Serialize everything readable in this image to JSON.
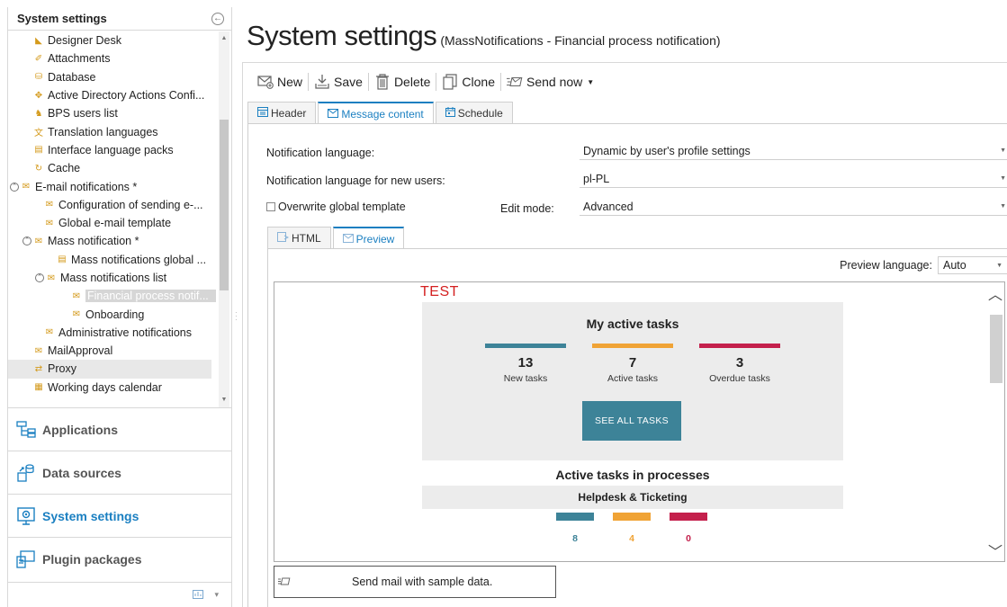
{
  "left": {
    "title": "System settings",
    "collapse_glyph": "←",
    "tree": [
      {
        "label": "Designer Desk",
        "icon": "pencil-ruler-icon",
        "glyph": "◣",
        "color": "#d49a1c",
        "indent": 28,
        "exp": ""
      },
      {
        "label": "Attachments",
        "icon": "paperclip-icon",
        "glyph": "✐",
        "color": "#d49a1c",
        "indent": 28,
        "exp": ""
      },
      {
        "label": "Database",
        "icon": "database-icon",
        "glyph": "⛁",
        "color": "#d49a1c",
        "indent": 28,
        "exp": ""
      },
      {
        "label": "Active Directory Actions Confi...",
        "icon": "directory-icon",
        "glyph": "✥",
        "color": "#d49a1c",
        "indent": 28,
        "exp": ""
      },
      {
        "label": "BPS users list",
        "icon": "users-icon",
        "glyph": "♞",
        "color": "#d49a1c",
        "indent": 28,
        "exp": ""
      },
      {
        "label": "Translation languages",
        "icon": "translate-icon",
        "glyph": "文",
        "color": "#d49a1c",
        "indent": 28,
        "exp": ""
      },
      {
        "label": "Interface language packs",
        "icon": "language-pack-icon",
        "glyph": "▤",
        "color": "#d49a1c",
        "indent": 28,
        "exp": ""
      },
      {
        "label": "Cache",
        "icon": "cache-icon",
        "glyph": "↻",
        "color": "#d49a1c",
        "indent": 28,
        "exp": ""
      },
      {
        "label": "E-mail notifications *",
        "icon": "envelope-icon",
        "glyph": "✉",
        "color": "#d49a1c",
        "indent": 14,
        "exp": "⊙"
      },
      {
        "label": "Configuration of sending e-...",
        "icon": "mail-config-icon",
        "glyph": "✉",
        "color": "#d49a1c",
        "indent": 40,
        "exp": ""
      },
      {
        "label": "Global e-mail template",
        "icon": "mail-template-icon",
        "glyph": "✉",
        "color": "#d49a1c",
        "indent": 40,
        "exp": ""
      },
      {
        "label": "Mass notification *",
        "icon": "mass-mail-icon",
        "glyph": "✉",
        "color": "#d49a1c",
        "indent": 28,
        "exp": "⊙"
      },
      {
        "label": "Mass notifications global ...",
        "icon": "mass-mail-global-icon",
        "glyph": "▤",
        "color": "#d49a1c",
        "indent": 54,
        "exp": ""
      },
      {
        "label": "Mass notifications list",
        "icon": "mass-mail-list-icon",
        "glyph": "✉",
        "color": "#d49a1c",
        "indent": 42,
        "exp": "⊙"
      },
      {
        "label": "Financial process notif...",
        "icon": "notification-item-icon",
        "glyph": "✉",
        "color": "#d49a1c",
        "indent": 70,
        "exp": "",
        "selected": true
      },
      {
        "label": "Onboarding",
        "icon": "notification-item-icon",
        "glyph": "✉",
        "color": "#d49a1c",
        "indent": 70,
        "exp": ""
      },
      {
        "label": "Administrative notifications",
        "icon": "admin-mail-icon",
        "glyph": "✉",
        "color": "#d49a1c",
        "indent": 40,
        "exp": ""
      },
      {
        "label": "MailApproval",
        "icon": "mail-approval-icon",
        "glyph": "✉",
        "color": "#d49a1c",
        "indent": 28,
        "exp": ""
      },
      {
        "label": "Proxy",
        "icon": "proxy-icon",
        "glyph": "⇄",
        "color": "#d49a1c",
        "indent": 28,
        "exp": "",
        "hover": true
      },
      {
        "label": "Working days calendar",
        "icon": "calendar-icon",
        "glyph": "▦",
        "color": "#d49a1c",
        "indent": 28,
        "exp": ""
      }
    ],
    "nav": [
      {
        "label": "Applications",
        "icon": "applications-icon",
        "active": false
      },
      {
        "label": "Data sources",
        "icon": "data-sources-icon",
        "active": false
      },
      {
        "label": "System settings",
        "icon": "system-settings-icon",
        "active": true
      },
      {
        "label": "Plugin packages",
        "icon": "plugin-packages-icon",
        "active": false
      }
    ]
  },
  "header": {
    "title": "System settings",
    "subtitle": "(MassNotifications - Financial process notification)"
  },
  "toolbar": {
    "new": "New",
    "save": "Save",
    "delete": "Delete",
    "clone": "Clone",
    "send_now": "Send now"
  },
  "tabs": [
    {
      "label": "Header",
      "icon": "header-icon"
    },
    {
      "label": "Message content",
      "icon": "message-content-icon"
    },
    {
      "label": "Schedule",
      "icon": "schedule-icon"
    }
  ],
  "form": {
    "notification_language_label": "Notification language:",
    "notification_language_value": "Dynamic by user's profile settings",
    "new_users_language_label": "Notification language for new users:",
    "new_users_language_value": "pl-PL",
    "overwrite_label": "Overwrite global template",
    "edit_mode_label": "Edit mode:",
    "edit_mode_value": "Advanced"
  },
  "inner_tabs": [
    {
      "label": "HTML",
      "icon": "html-icon"
    },
    {
      "label": "Preview",
      "icon": "preview-icon"
    }
  ],
  "preview": {
    "language_label": "Preview language:",
    "language_value": "Auto",
    "test_label": "TEST",
    "tasks_title": "My active tasks",
    "stats": [
      {
        "num": "13",
        "cap": "New tasks",
        "color": "#3d8398"
      },
      {
        "num": "7",
        "cap": "Active tasks",
        "color": "#f0a335"
      },
      {
        "num": "3",
        "cap": "Overdue tasks",
        "color": "#c4204c"
      }
    ],
    "see_all": "SEE ALL TASKS",
    "processes_title": "Active tasks in processes",
    "process_name": "Helpdesk & Ticketing",
    "process_stats": [
      {
        "num": "8",
        "color": "#3d8398"
      },
      {
        "num": "4",
        "color": "#f0a335"
      },
      {
        "num": "0",
        "color": "#c4204c"
      }
    ],
    "send_sample": "Send mail with sample data."
  }
}
